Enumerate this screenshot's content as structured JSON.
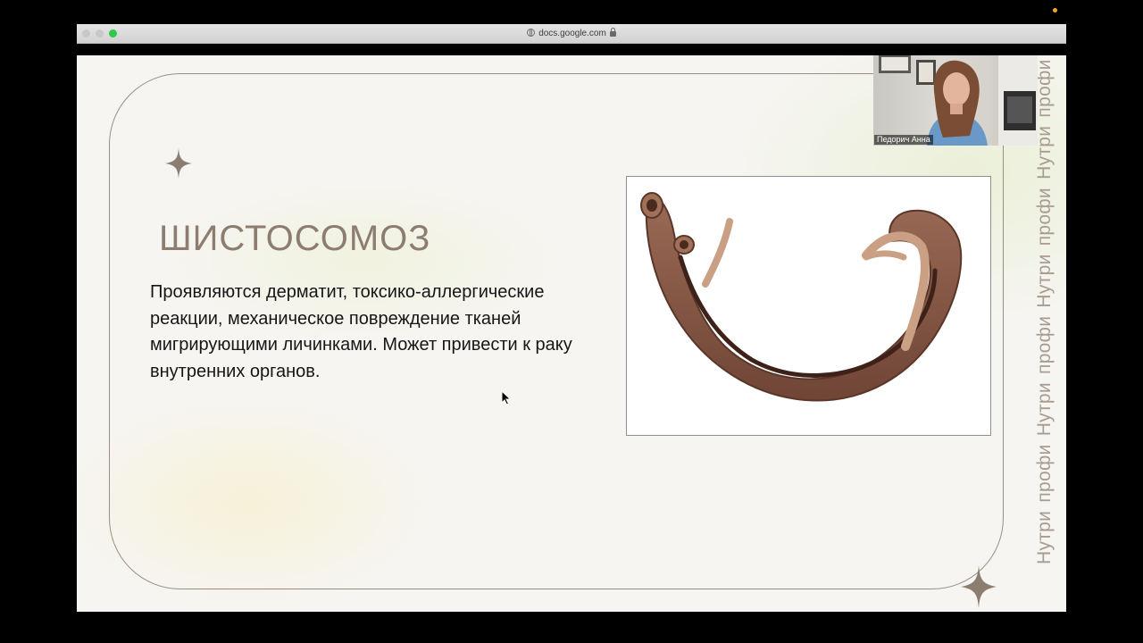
{
  "browser": {
    "url": "docs.google.com"
  },
  "slide": {
    "title": "ШИСТОСОМОЗ",
    "body": "Проявляются дерматит, токсико-аллергические реакции, механическое повреждение тканей мигрирующими личинками. Может привести к раку внутренних органов.",
    "watermark": "Нутри профи  Нутри профи  Нутри профи  Нутри профи"
  },
  "webcam": {
    "participant_name": "Педорич Анна"
  },
  "icons": {
    "decor_top": "sparkle-icon",
    "decor_bottom": "sparkle-icon",
    "secure": "lock-icon",
    "site": "globe-icon"
  },
  "colors": {
    "accent": "#8c7d70",
    "frame": "#9c8f82",
    "maximize_button": "#2ec84a",
    "recording_indicator": "#f0a830"
  }
}
